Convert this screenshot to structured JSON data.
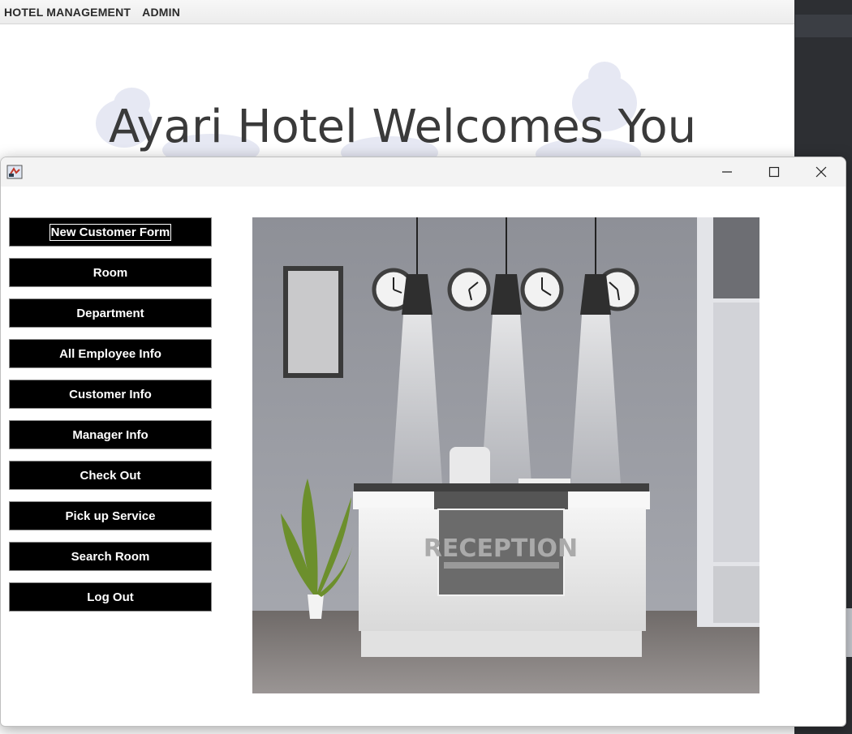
{
  "main_window": {
    "menu": [
      "HOTEL MANAGEMENT",
      "ADMIN"
    ],
    "welcome_text": "Ayari Hotel Welcomes You"
  },
  "dialog": {
    "buttons": [
      {
        "label": "New Customer Form",
        "focused": true
      },
      {
        "label": "Room"
      },
      {
        "label": "Department"
      },
      {
        "label": "All Employee Info"
      },
      {
        "label": "Customer Info"
      },
      {
        "label": "Manager Info"
      },
      {
        "label": "Check Out"
      },
      {
        "label": "Pick up Service"
      },
      {
        "label": "Search Room"
      },
      {
        "label": "Log Out"
      }
    ],
    "image_sign": "RECEPTION"
  },
  "icons": {
    "app": "java-app-icon",
    "minimize": "minimize-icon",
    "maximize": "maximize-icon",
    "close": "close-icon"
  }
}
